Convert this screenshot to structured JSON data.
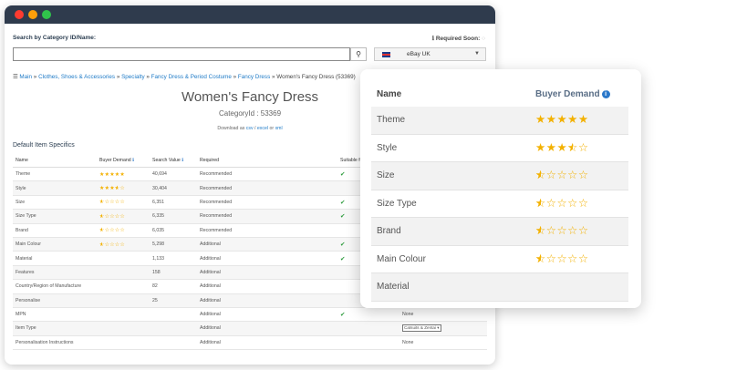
{
  "window": {
    "search": {
      "label": "Search by Category ID/Name:",
      "required_soon": "Required Soon:",
      "input_value": "",
      "marketplace": "eBay UK"
    },
    "breadcrumb": {
      "icon": "list-icon",
      "items": [
        "Main",
        "Clothes, Shoes & Accessories",
        "Specialty",
        "Fancy Dress & Period Costume",
        "Fancy Dress"
      ],
      "current": "Women's Fancy Dress (53369)"
    },
    "title": "Women's Fancy Dress",
    "category_id": "CategoryId : 53369",
    "download": {
      "prefix": "Download as",
      "csv": "csv",
      "sep": "/",
      "excel": "excel",
      "or": "or",
      "xml": "xml"
    },
    "section_label": "Default Item Specifics",
    "table": {
      "columns": [
        "Name",
        "Buyer Demand",
        "Search Value",
        "Required",
        "Suitable for V"
      ],
      "rows": [
        {
          "name": "Theme",
          "demand": 5,
          "search": "40,694",
          "required": "Recommended",
          "check": true,
          "value": ""
        },
        {
          "name": "Style",
          "demand": 3.5,
          "search": "30,404",
          "required": "Recommended",
          "check": false,
          "value": ""
        },
        {
          "name": "Size",
          "demand": 0.5,
          "search": "6,351",
          "required": "Recommended",
          "check": true,
          "value": ""
        },
        {
          "name": "Size Type",
          "demand": 0.5,
          "search": "6,335",
          "required": "Recommended",
          "check": true,
          "value": ""
        },
        {
          "name": "Brand",
          "demand": 0.5,
          "search": "6,035",
          "required": "Recommended",
          "check": false,
          "value": ""
        },
        {
          "name": "Main Colour",
          "demand": 0.5,
          "search": "5,298",
          "required": "Additional",
          "check": true,
          "value": ""
        },
        {
          "name": "Material",
          "demand": null,
          "search": "1,133",
          "required": "Additional",
          "check": true,
          "value": ""
        },
        {
          "name": "Features",
          "demand": null,
          "search": "158",
          "required": "Additional",
          "check": false,
          "value": ""
        },
        {
          "name": "Country/Region of Manufacture",
          "demand": null,
          "search": "82",
          "required": "Additional",
          "check": false,
          "value": ""
        },
        {
          "name": "Personalise",
          "demand": null,
          "search": "25",
          "required": "Additional",
          "check": false,
          "value": ""
        },
        {
          "name": "MPN",
          "demand": null,
          "search": "",
          "required": "Additional",
          "check": true,
          "value": "None"
        },
        {
          "name": "Item Type",
          "demand": null,
          "search": "",
          "required": "Additional",
          "check": false,
          "value": "Catsuits & Zentai",
          "select": true
        },
        {
          "name": "Personalisation Instructions",
          "demand": null,
          "search": "",
          "required": "Additional",
          "check": false,
          "value": "None"
        }
      ]
    }
  },
  "popup": {
    "header_name": "Name",
    "header_demand": "Buyer Demand",
    "info_glyph": "i",
    "rows": [
      {
        "name": "Theme",
        "demand": 5
      },
      {
        "name": "Style",
        "demand": 3.5
      },
      {
        "name": "Size",
        "demand": 0.5
      },
      {
        "name": "Size Type",
        "demand": 0.5
      },
      {
        "name": "Brand",
        "demand": 0.5
      },
      {
        "name": "Main Colour",
        "demand": 0.5
      },
      {
        "name": "Material",
        "demand": null
      }
    ]
  },
  "colors": {
    "titlebar": "#2f3b4d",
    "link": "#1f7bc7",
    "star": "#f3b100",
    "check": "#2a9a3a",
    "info": "#2a77c9"
  }
}
